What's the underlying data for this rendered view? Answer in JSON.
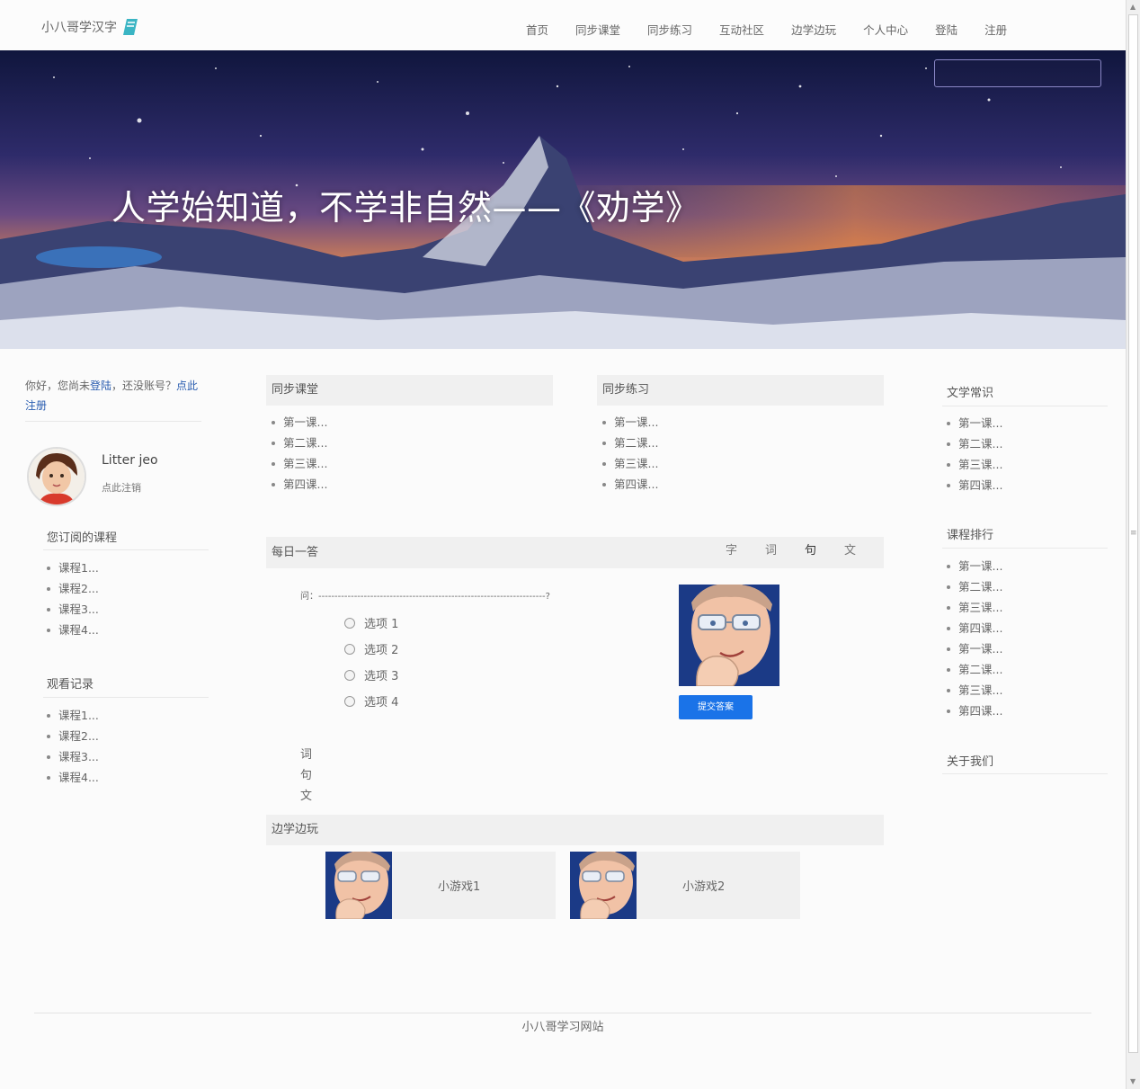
{
  "header": {
    "brand": "小八哥学汉字",
    "nav": [
      "首页",
      "同步课堂",
      "同步练习",
      "互动社区",
      "边学边玩",
      "个人中心",
      "登陆",
      "注册"
    ]
  },
  "banner": {
    "quote": "人学始知道，不学非自然——《劝学》",
    "search_placeholder": ""
  },
  "sidebar": {
    "greeting_prefix": "你好，您尚未",
    "login_link": "登陆",
    "greeting_mid": "，还没账号？",
    "register_link": "点此注册",
    "user_name": "Litter jeo",
    "logout": "点此注销",
    "subscribed_title": "您订阅的课程",
    "subscribed": [
      "课程1...",
      "课程2...",
      "课程3...",
      "课程4..."
    ],
    "history_title": "观看记录",
    "history": [
      "课程1...",
      "课程2...",
      "课程3...",
      "课程4..."
    ]
  },
  "sync_class": {
    "title": "同步课堂",
    "items": [
      "第一课...",
      "第二课...",
      "第三课...",
      "第四课..."
    ]
  },
  "sync_practice": {
    "title": "同步练习",
    "items": [
      "第一课...",
      "第二课...",
      "第三课...",
      "第四课..."
    ]
  },
  "daily": {
    "title": "每日一答",
    "tabs": [
      "字",
      "词",
      "句",
      "文"
    ],
    "active_tab": "句",
    "question": "问：----------------------------------------------------------------------?",
    "options": [
      "选项 1",
      "选项 2",
      "选项 3",
      "选项 4"
    ],
    "submit": "提交答案",
    "vertical_words": [
      "词",
      "句",
      "文"
    ]
  },
  "games": {
    "title": "边学边玩",
    "items": [
      "小游戏1",
      "小游戏2"
    ]
  },
  "right": {
    "literature_title": "文学常识",
    "literature": [
      "第一课...",
      "第二课...",
      "第三课...",
      "第四课..."
    ],
    "ranking_title": "课程排行",
    "ranking": [
      "第一课...",
      "第二课...",
      "第三课...",
      "第四课...",
      "第一课...",
      "第二课...",
      "第三课...",
      "第四课..."
    ],
    "about_title": "关于我们"
  },
  "footer": {
    "text": "小八哥学习网站"
  },
  "colors": {
    "link": "#2a5db0",
    "button": "#1a73e8",
    "panel_bg": "#f0f0f0",
    "brand_icon": "#3bb5c4"
  }
}
